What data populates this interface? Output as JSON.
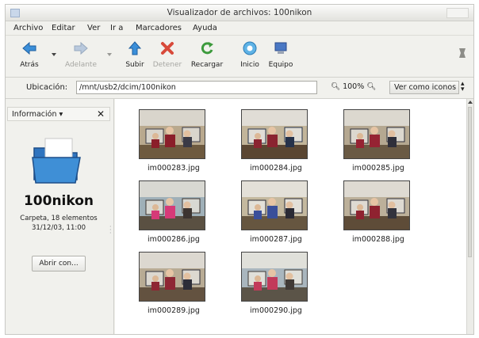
{
  "window": {
    "title": "Visualizador de archivos: 100nikon"
  },
  "menu": [
    "Archivo",
    "Editar",
    "Ver",
    "Ir a",
    "Marcadores",
    "Ayuda"
  ],
  "toolbar": {
    "back": "Atrás",
    "forward": "Adelante",
    "up": "Subir",
    "stop": "Detener",
    "reload": "Recargar",
    "home": "Inicio",
    "computer": "Equipo"
  },
  "location": {
    "label": "Ubicación:",
    "value": "/mnt/usb2/dcim/100nikon",
    "zoom": "100%",
    "view_mode": "Ver como iconos"
  },
  "sidebar": {
    "header": "Información",
    "title": "100nikon",
    "subtitle": "Carpeta, 18 elementos",
    "date": "31/12/03, 11:00",
    "open_with": "Abrir con..."
  },
  "files": [
    {
      "name": "im000283.jpg"
    },
    {
      "name": "im000284.jpg"
    },
    {
      "name": "im000285.jpg"
    },
    {
      "name": "im000286.jpg"
    },
    {
      "name": "im000287.jpg"
    },
    {
      "name": "im000288.jpg"
    },
    {
      "name": "im000289.jpg"
    },
    {
      "name": "im000290.jpg"
    }
  ],
  "colors": {
    "folder": "#3f8fd6",
    "accent": "#3b6fb6"
  }
}
